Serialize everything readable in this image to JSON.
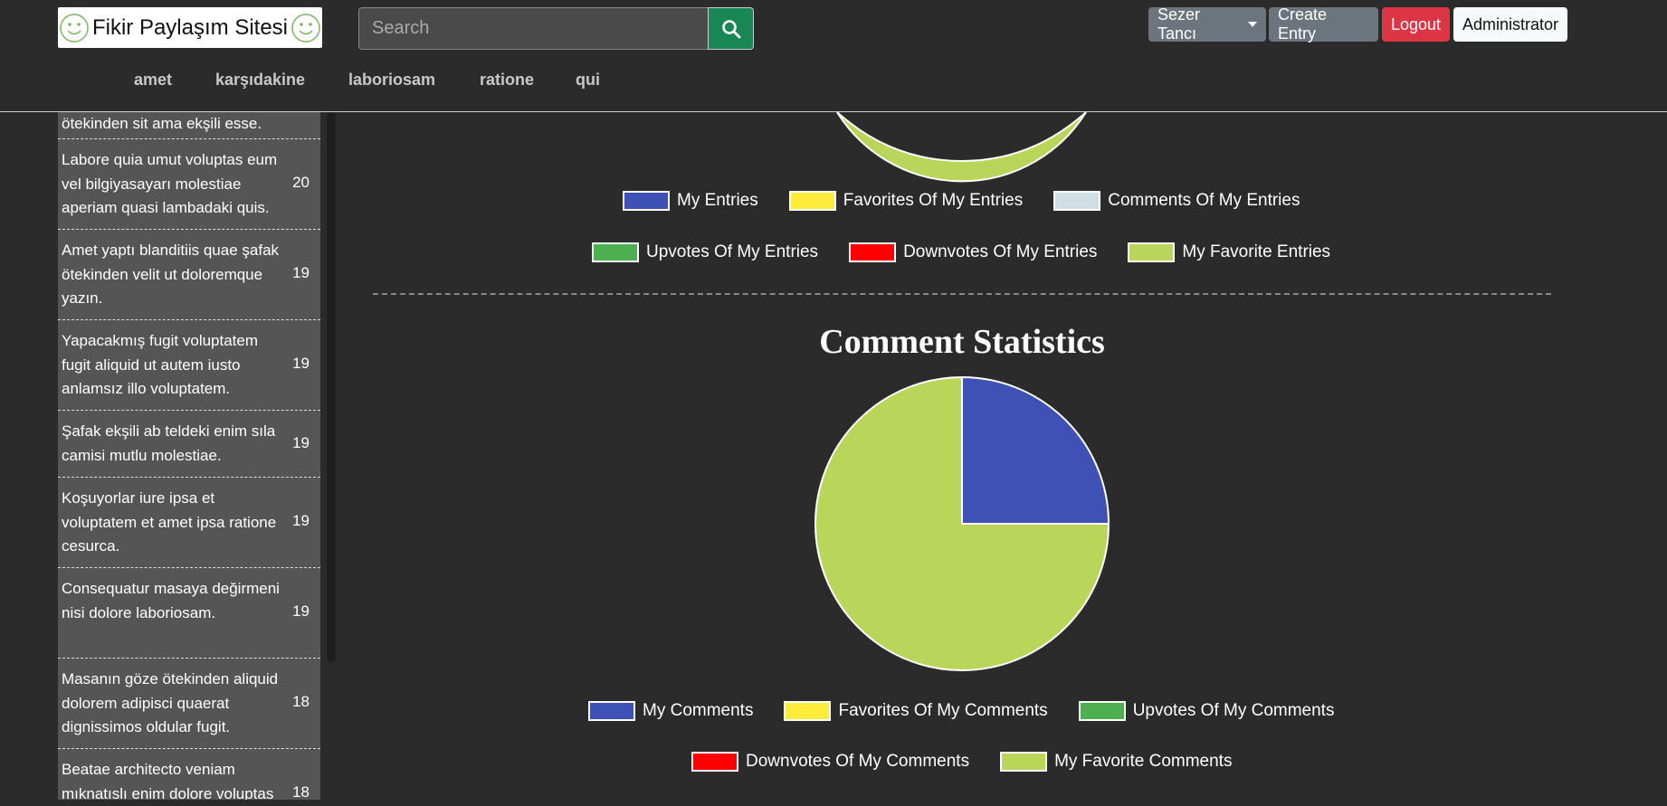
{
  "header": {
    "logo_text": "Fikir Paylaşım Sitesi",
    "search_placeholder": "Search",
    "user_button": "Sezer Tancı",
    "create_entry": "Create Entry",
    "logout": "Logout",
    "admin": "Administrator"
  },
  "nav": [
    "amet",
    "karşıdakine",
    "laboriosam",
    "ratione",
    "qui"
  ],
  "sidebar": {
    "items": [
      {
        "text": "ötekinden sit ama ekşili esse.",
        "count": ""
      },
      {
        "text": "Labore quia umut voluptas eum vel bilgiyasayarı molestiae aperiam quasi lambadaki quis.",
        "count": "20"
      },
      {
        "text": "Amet yaptı blanditiis quae şafak ötekinden velit ut doloremque yazın.",
        "count": "19"
      },
      {
        "text": "Yapacakmış fugit voluptatem fugit aliquid ut autem iusto anlamsız illo voluptatem.",
        "count": "19"
      },
      {
        "text": "Şafak ekşili ab teldeki enim sıla camisi mutlu molestiae.",
        "count": "19"
      },
      {
        "text": "Koşuyorlar iure ipsa et voluptatem et amet ipsa ratione cesurca.",
        "count": "19"
      },
      {
        "text": "Consequatur masaya değirmeni nisi dolore laboriosam.",
        "count": "19"
      },
      {
        "text": "Masanın göze ötekinden aliquid dolorem adipisci quaerat dignissimos oldular fugit.",
        "count": "18"
      },
      {
        "text": "Beatae architecto veniam mıknatıslı enim dolore voluptas",
        "count": "18"
      }
    ]
  },
  "entry_legend": [
    {
      "label": "My Entries",
      "color": "#3f51b5"
    },
    {
      "label": "Favorites Of My Entries",
      "color": "#ffeb3b"
    },
    {
      "label": "Comments Of My Entries",
      "color": "#cfdfe3"
    },
    {
      "label": "Upvotes Of My Entries",
      "color": "#4caf50"
    },
    {
      "label": "Downvotes Of My Entries",
      "color": "#ff0000"
    },
    {
      "label": "My Favorite Entries",
      "color": "#b9d55a"
    }
  ],
  "comment_stats": {
    "title": "Comment Statistics"
  },
  "chart_data": {
    "type": "pie",
    "title": "Comment Statistics",
    "categories": [
      "My Comments",
      "Favorites Of My Comments",
      "Upvotes Of My Comments",
      "Downvotes Of My Comments",
      "My Favorite Comments"
    ],
    "values": [
      1,
      0,
      0,
      0,
      3
    ],
    "colors": [
      "#3f51b5",
      "#ffeb3b",
      "#4caf50",
      "#ff0000",
      "#b9d55a"
    ],
    "legend_placement": "bottom"
  }
}
